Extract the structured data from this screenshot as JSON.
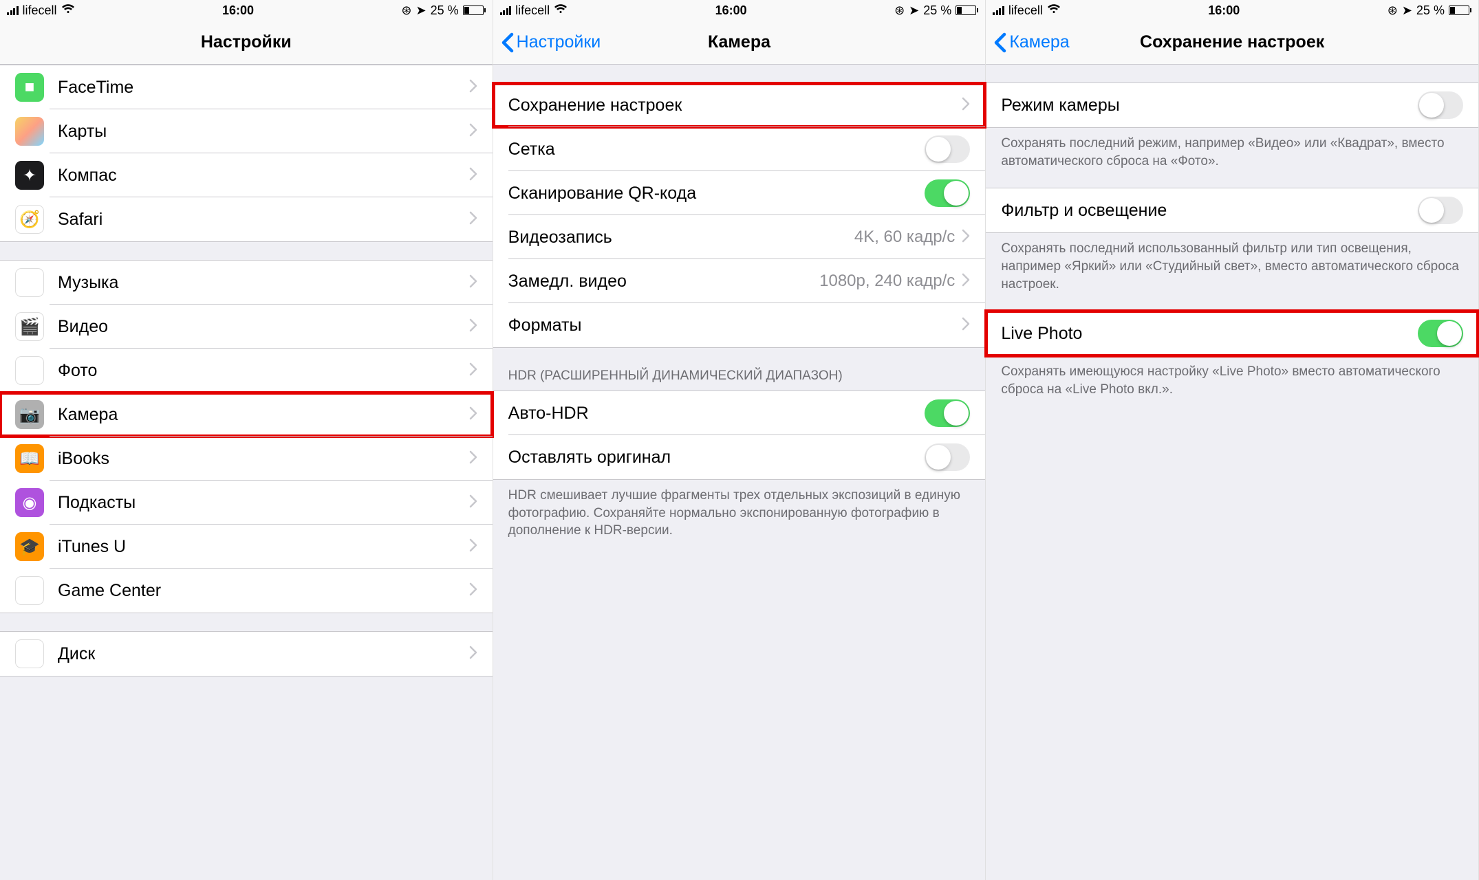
{
  "status": {
    "carrier": "lifecell",
    "time": "16:00",
    "battery_pct": "25 %",
    "alarm_glyph": "⊛",
    "location_glyph": "➤"
  },
  "screen1": {
    "title": "Настройки",
    "group_a": [
      {
        "label": "FaceTime",
        "icon_name": "facetime-icon",
        "icon_class": "bg-facetime",
        "glyph": "■"
      },
      {
        "label": "Карты",
        "icon_name": "maps-icon",
        "icon_class": "bg-maps",
        "glyph": ""
      },
      {
        "label": "Компас",
        "icon_name": "compass-icon",
        "icon_class": "bg-compass",
        "glyph": "✦"
      },
      {
        "label": "Safari",
        "icon_name": "safari-icon",
        "icon_class": "bg-safari",
        "glyph": "🧭"
      }
    ],
    "group_b": [
      {
        "label": "Музыка",
        "icon_name": "music-icon",
        "icon_class": "bg-music",
        "glyph": "♫"
      },
      {
        "label": "Видео",
        "icon_name": "video-icon",
        "icon_class": "bg-video",
        "glyph": "🎬"
      },
      {
        "label": "Фото",
        "icon_name": "photos-icon",
        "icon_class": "bg-photos",
        "glyph": "❀"
      },
      {
        "label": "Камера",
        "icon_name": "camera-icon",
        "icon_class": "bg-camera",
        "glyph": "📷",
        "highlight": true
      },
      {
        "label": "iBooks",
        "icon_name": "ibooks-icon",
        "icon_class": "bg-ibooks",
        "glyph": "📖"
      },
      {
        "label": "Подкасты",
        "icon_name": "podcasts-icon",
        "icon_class": "bg-podcasts",
        "glyph": "◉"
      },
      {
        "label": "iTunes U",
        "icon_name": "itunesu-icon",
        "icon_class": "bg-itunesu",
        "glyph": "🎓"
      },
      {
        "label": "Game Center",
        "icon_name": "gamecenter-icon",
        "icon_class": "bg-gamecenter",
        "glyph": "●●"
      }
    ],
    "group_c": [
      {
        "label": "Диск",
        "icon_name": "drive-icon",
        "icon_class": "bg-drive",
        "glyph": "▲"
      }
    ]
  },
  "screen2": {
    "back_label": "Настройки",
    "title": "Камера",
    "group_a": [
      {
        "label": "Сохранение настроек",
        "type": "nav",
        "highlight": true
      },
      {
        "label": "Сетка",
        "type": "toggle",
        "on": false
      },
      {
        "label": "Сканирование QR-кода",
        "type": "toggle",
        "on": true
      },
      {
        "label": "Видеозапись",
        "type": "nav",
        "detail": "4K, 60 кадр/с"
      },
      {
        "label": "Замедл. видео",
        "type": "nav",
        "detail": "1080p, 240 кадр/с"
      },
      {
        "label": "Форматы",
        "type": "nav"
      }
    ],
    "hdr_header": "HDR (РАСШИРЕННЫЙ ДИНАМИЧЕСКИЙ ДИАПАЗОН)",
    "group_hdr": [
      {
        "label": "Авто-HDR",
        "type": "toggle",
        "on": true
      },
      {
        "label": "Оставлять оригинал",
        "type": "toggle",
        "on": false
      }
    ],
    "hdr_footer": "HDR смешивает лучшие фрагменты трех отдельных экспозиций в единую фотографию. Сохраняйте нормально экспонированную фотографию в дополнение к HDR-версии."
  },
  "screen3": {
    "back_label": "Камера",
    "title": "Сохранение настроек",
    "items": [
      {
        "label": "Режим камеры",
        "on": false,
        "footer": "Сохранять последний режим, например «Видео» или «Квадрат», вместо автоматического сброса на «Фото»."
      },
      {
        "label": "Фильтр и освещение",
        "on": false,
        "footer": "Сохранять последний использованный фильтр или тип освещения, например «Яркий» или «Студийный свет», вместо автоматического сброса настроек."
      },
      {
        "label": "Live Photo",
        "on": true,
        "highlight": true,
        "footer": "Сохранять имеющуюся настройку «Live Photo» вместо автоматического сброса на «Live Photo вкл.»."
      }
    ]
  }
}
